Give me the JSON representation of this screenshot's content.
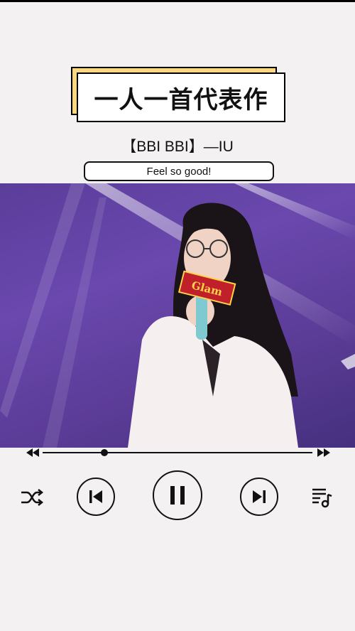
{
  "header": {
    "title": "一人一首代表作",
    "subtitle": "【BBI BBI】—IU",
    "tagline": "Feel so good!"
  },
  "media": {
    "mic_flag_text": "Glam"
  },
  "player": {
    "progress_fraction": 0.23,
    "icons": [
      "fast-rewind-icon",
      "fast-forward-icon",
      "shuffle-icon",
      "skip-previous-icon",
      "pause-icon",
      "skip-next-icon",
      "playlist-icon"
    ]
  },
  "colors": {
    "accent_yellow": "#ffd97f",
    "stage_purple": "#5b3d9a",
    "jacket_white": "#f5f0ef"
  }
}
